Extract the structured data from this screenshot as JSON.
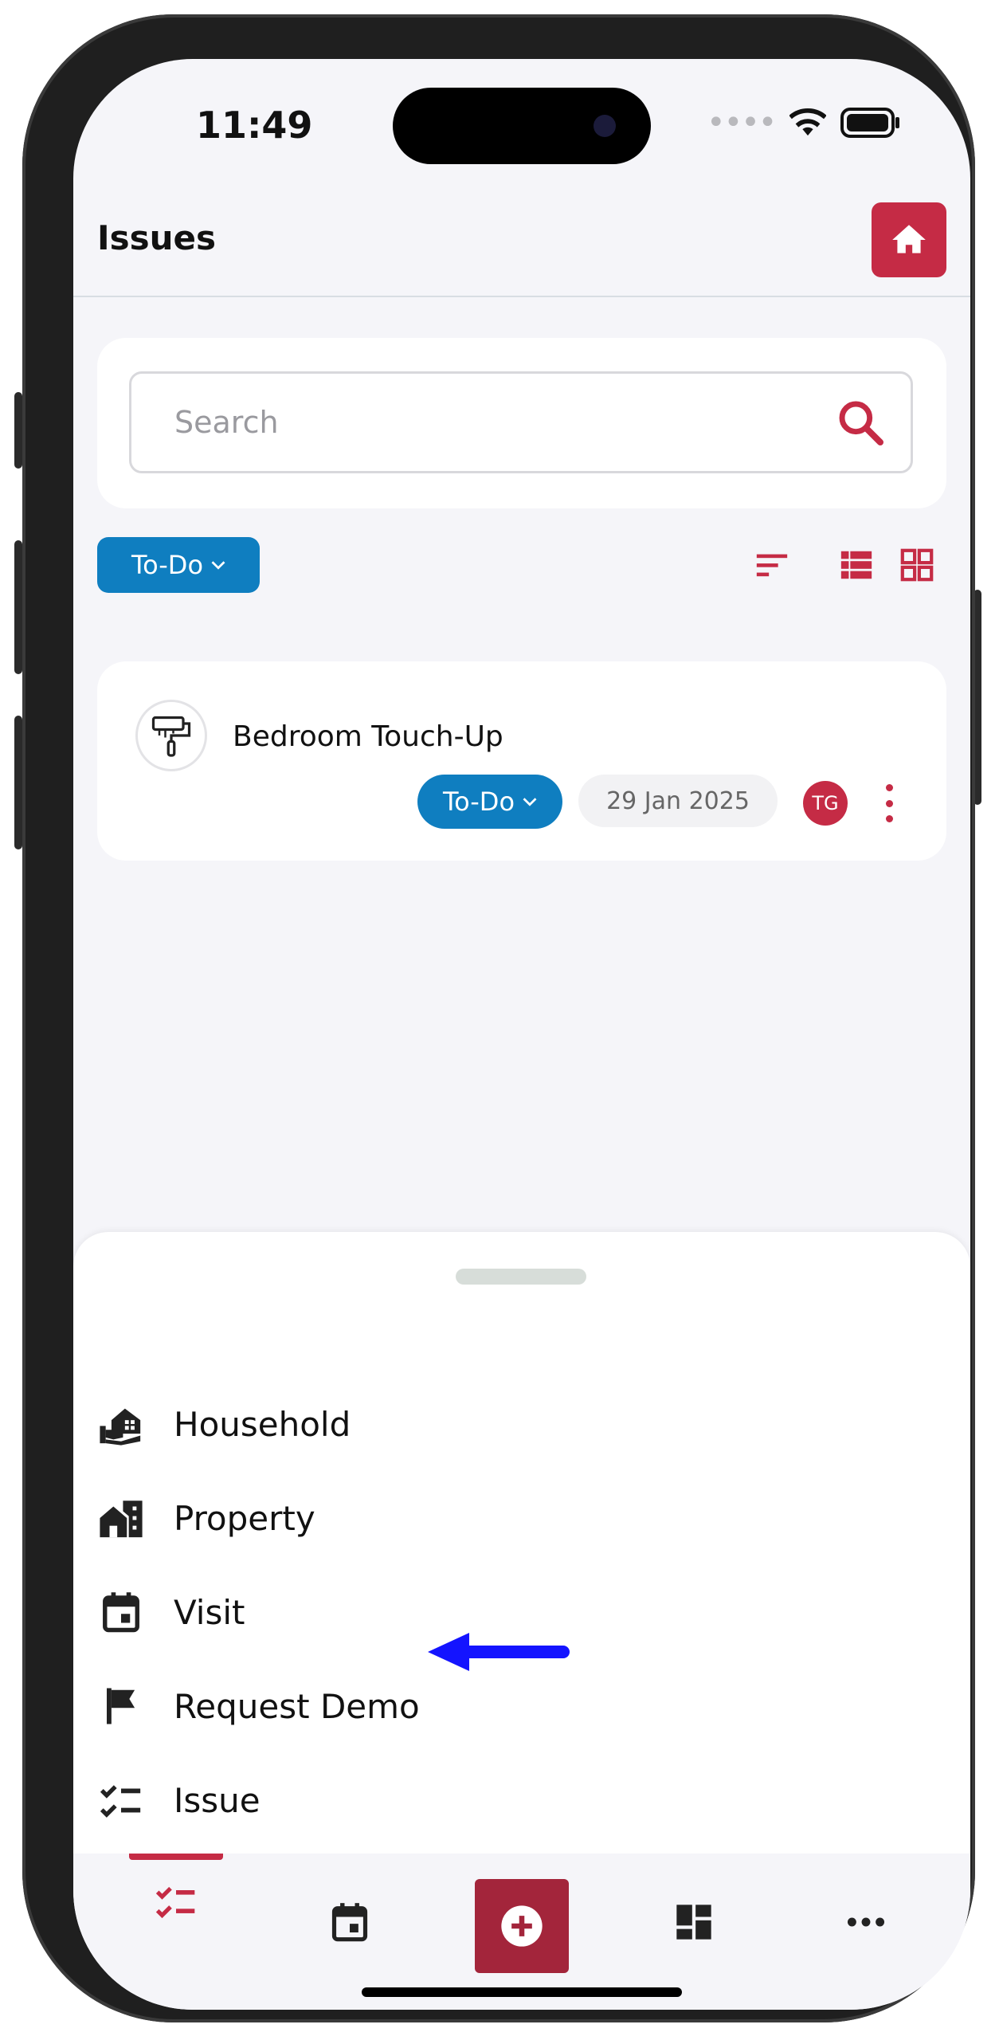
{
  "status_bar": {
    "time": "11:49"
  },
  "header": {
    "title": "Issues"
  },
  "search": {
    "placeholder": "Search"
  },
  "filter": {
    "status_label": "To-Do"
  },
  "issue": {
    "title": "Bedroom Touch-Up",
    "status": "To-Do",
    "date": "29 Jan 2025",
    "assignee_initials": "TG"
  },
  "menu": {
    "items": [
      {
        "label": "Household",
        "icon": "household-icon"
      },
      {
        "label": "Property",
        "icon": "property-icon"
      },
      {
        "label": "Visit",
        "icon": "calendar-icon"
      },
      {
        "label": "Request Demo",
        "icon": "flag-icon"
      },
      {
        "label": "Issue",
        "icon": "checklist-icon"
      }
    ]
  },
  "colors": {
    "brand": "#c52b45",
    "accent_blue": "#0f7ec0",
    "annotation_arrow": "#1414ff"
  }
}
